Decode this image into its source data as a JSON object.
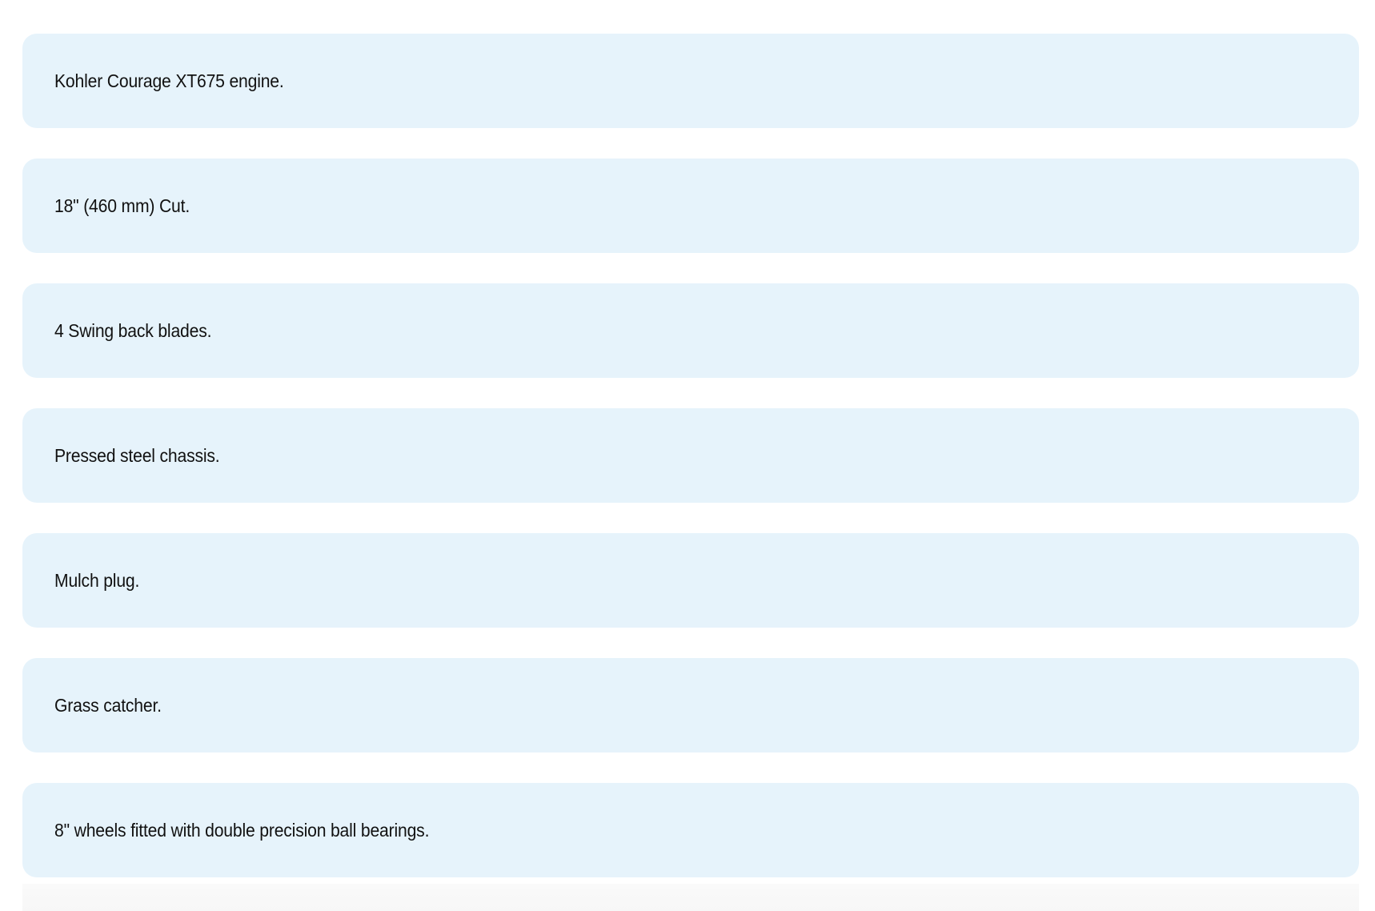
{
  "features": [
    "Kohler Courage XT675 engine.",
    "18\" (460 mm) Cut.",
    "4 Swing back blades.",
    "Pressed steel chassis.",
    "Mulch plug.",
    "Grass catcher.",
    "8\" wheels fitted with double precision ball bearings."
  ],
  "colors": {
    "card_background": "#e6f3fb",
    "text": "#111111",
    "page_background": "#ffffff"
  }
}
